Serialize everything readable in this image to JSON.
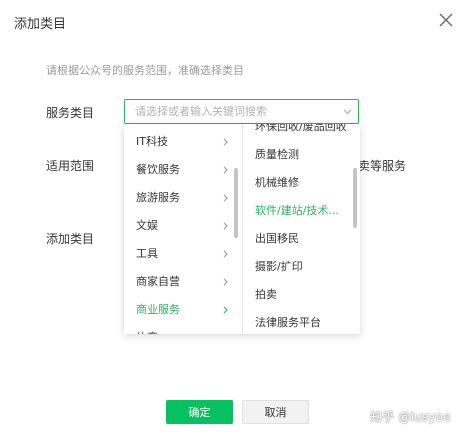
{
  "dialog": {
    "title": "添加类目",
    "hint": "请根据公众号的服务范围，准确选择类目"
  },
  "form": {
    "service_category_label": "服务类目",
    "scope_label": "适用范围",
    "add_category_label": "添加类目",
    "search_placeholder": "请选择或者输入关键词搜索",
    "search_value": "",
    "scope_side_text": "卖等服务"
  },
  "dropdown": {
    "left_items": [
      {
        "label": "IT科技"
      },
      {
        "label": "餐饮服务"
      },
      {
        "label": "旅游服务"
      },
      {
        "label": "文娱"
      },
      {
        "label": "工具"
      },
      {
        "label": "商家自营"
      },
      {
        "label": "商业服务"
      },
      {
        "label": "体育"
      }
    ],
    "left_active_index": 6,
    "right_items": [
      {
        "label": "环保回收/废品回收"
      },
      {
        "label": "质量检测"
      },
      {
        "label": "机械维修"
      },
      {
        "label": "软件/建站/技术..."
      },
      {
        "label": "出国移民"
      },
      {
        "label": "摄影/扩印"
      },
      {
        "label": "拍卖"
      },
      {
        "label": "法律服务平台"
      }
    ],
    "right_active_index": 3
  },
  "buttons": {
    "confirm_label": "确定",
    "cancel_label": "取消"
  },
  "colors": {
    "accent": "#07c160",
    "active_text": "#2fb05f"
  },
  "watermark": "知乎 @lusyoe"
}
